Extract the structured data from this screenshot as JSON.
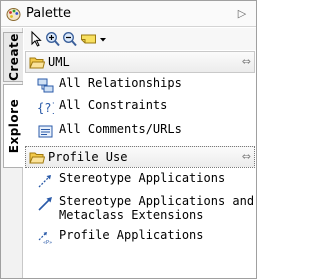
{
  "window": {
    "title": "Palette",
    "icon": "palette-icon",
    "collapse_glyph": "▷"
  },
  "side_tabs": [
    {
      "label": "Create",
      "active": false
    },
    {
      "label": "Explore",
      "active": true
    }
  ],
  "toolbar": {
    "tools": [
      "select-arrow-icon",
      "zoom-in-icon",
      "zoom-out-icon",
      "note-icon",
      "dropdown-arrow-icon"
    ]
  },
  "drawers": {
    "uml": {
      "label": "UML",
      "pin": "⇔",
      "items": [
        {
          "label": "All Relationships",
          "icon": "relationships-icon"
        },
        {
          "label": "All Constraints",
          "icon": "constraints-icon"
        },
        {
          "label": "All Comments/URLs",
          "icon": "comments-icon"
        }
      ]
    },
    "profile_use": {
      "label": "Profile Use",
      "pin": "⇔",
      "items": [
        {
          "label": "Stereotype Applications",
          "icon": "stereotype-application-icon"
        },
        {
          "label": "Stereotype Applications and",
          "label_line2": "Metaclass Extensions",
          "icon": "stereotype-extension-icon"
        },
        {
          "label": "Profile Applications",
          "icon": "profile-application-icon"
        }
      ]
    }
  },
  "colors": {
    "folder": "#f0c030",
    "accent_blue": "#2a5aa8",
    "drawer_border": "#c9c9c9"
  }
}
